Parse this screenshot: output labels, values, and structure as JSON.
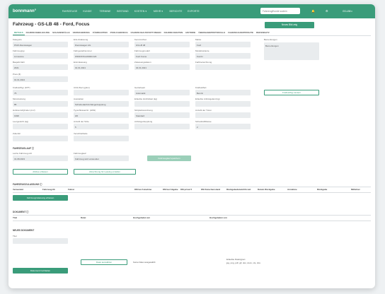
{
  "app": {
    "logo": "bonnmann°",
    "nav": [
      "FAHRZEUGE",
      "KUNDE",
      "TERMINE",
      "BESTAND",
      "KOSTEN ▾",
      "MEHR ▾",
      "BERICHTE",
      "EXPORTE"
    ],
    "search_placeholder": "Fahrzeug/Kunde suchen",
    "user_label": "GS-LB8 ▾"
  },
  "page": {
    "title": "Fahrzeug - GS-LB 48 - Ford, Focus",
    "cta": "Neues Bild zeig",
    "tabs": [
      "DETAILS",
      "FAHRZEUGBELEGUNG",
      "SCHADENFÄLLE",
      "VERSICHERUNG",
      "FÜHRKARTEN",
      "POOLFAHRZEUG",
      "FAHRZEUGAUSSTATTUNGEN",
      "FAHRZEUGDATEN",
      "HISTORIE",
      "ÜBERGABEPROTOKOLLE",
      "FAHRZEUGZERTIFIKATE",
      "REIFENSATZ"
    ]
  },
  "fields": {
    "row1": [
      {
        "label": "Kategorie",
        "value": "PKW-Dienstwagen"
      },
      {
        "label": "Erst-Zulassung",
        "value": "Dienstwagen AG"
      },
      {
        "label": "Kennzeichen",
        "value": "GS-LB 48"
      },
      {
        "label": "Marke",
        "value": "Ford"
      },
      {
        "label": "Bemerkungen",
        "value": "Bemerkungen"
      }
    ],
    "row2": [
      {
        "label": "Fahrzeugtyp",
        "value": "Limousine"
      },
      {
        "label": "Fahrgestellnummer",
        "value": "WF0DXXGAKDDU123"
      },
      {
        "label": "Fahrzeugmodell",
        "value": "Ford Focus"
      },
      {
        "label": "Modellvariante",
        "value": "Kombi"
      }
    ],
    "row3": [
      {
        "label": "Baujahr/Jahr",
        "value": "2021"
      },
      {
        "label": "Erstzulassung",
        "value": "01.01.2021"
      },
      {
        "label": "Zulassungsdatum",
        "value": "04.01.2021"
      },
      {
        "label": "Farbbezeichnung",
        "value": ""
      }
    ],
    "row4": [
      {
        "label": "Preis (€)",
        "value": "01.01.2024"
      }
    ],
    "row5": [
      {
        "label": "Kraftstofftyp (FPT)",
        "value": "75"
      },
      {
        "label": "CO2-Wert (g/km)",
        "value": ""
      },
      {
        "label": "Getriebeart",
        "value": "Automatik"
      },
      {
        "label": "Kraftstoffart",
        "value": "Benzin"
      }
    ],
    "row5_button": "Kraftstofftyp ändern",
    "row6": [
      {
        "label": "Motorleistung",
        "value": "85"
      },
      {
        "label": "Ausstatten",
        "value": "Schiebedach/Anhängerkupplung"
      },
      {
        "label": "Erlaubte Höchstlast (kg)",
        "value": ""
      },
      {
        "label": "Erlaubte Anhängelast (kg)",
        "value": ""
      }
    ],
    "row7": [
      {
        "label": "Hubraum/Zylinder (cm³)",
        "value": "1998"
      },
      {
        "label": "Typschlüssel-Nr. (HSN)",
        "value": "0/0"
      },
      {
        "label": "Sitzplatzanordnung",
        "value": "Standard"
      },
      {
        "label": "Anzahl der Türen",
        "value": ""
      }
    ],
    "row8": [
      {
        "label": "Leergewicht (kg)",
        "value": ""
      },
      {
        "label": "Anzahl der Sitze",
        "value": "5"
      },
      {
        "label": "Anhängerkupplung",
        "value": ""
      },
      {
        "label": "Schadstoffklasse",
        "value": "2"
      }
    ],
    "row9": [
      {
        "label": "Zubehör",
        "value": ""
      },
      {
        "label": "Verschleißteile",
        "value": ""
      }
    ]
  },
  "fahrzeuglauf": {
    "section": "FAHRZEUGLAUF ⓘ",
    "fields": [
      {
        "label": "Letzte Fahrzeug-HU",
        "value": "31.08.2023"
      },
      {
        "label": "Fahrzeuglauf",
        "value": "Fahrzeug wird verwendet"
      }
    ],
    "button": "Fahrzeuglauf speichern",
    "buttons": [
      "Ablöse erfassen",
      "Abrechnung für Leasing erstellen"
    ]
  },
  "zulassung": {
    "section": "FAHRZEUGZULASSUNG ⓘ",
    "columns": [
      "Verwendet",
      "Fahrzeug-Nr.",
      "Fahrer",
      "KM bei Annahme",
      "KM bei Abgabe",
      "KM privat ▾",
      "KM Zwischenstand",
      "Rückgabedatum/Uhrzeit",
      "Datum Rückgabe",
      "Annahme",
      "Rückgabe",
      "Mitfahrer"
    ],
    "button": "Fahrzeugzulassung erfassen"
  },
  "dokument": {
    "section": "DOKUMENT ⓘ",
    "columns": [
      "Titel",
      "Datei",
      "Hochgeladen am",
      "Hochgeladen von"
    ]
  },
  "neues_dokument": {
    "section": "NEUES DOKUMENT",
    "title_label": "Titel",
    "file_button": "Datei auswählen",
    "file_status": "Keine Datei ausgewählt",
    "hint_lines": [
      "Erlaubte Dateitypen:",
      "jpg, png, pdf, gif, doc, docx, xls, xlsx"
    ],
    "save_button": "Dokument hochladen"
  }
}
